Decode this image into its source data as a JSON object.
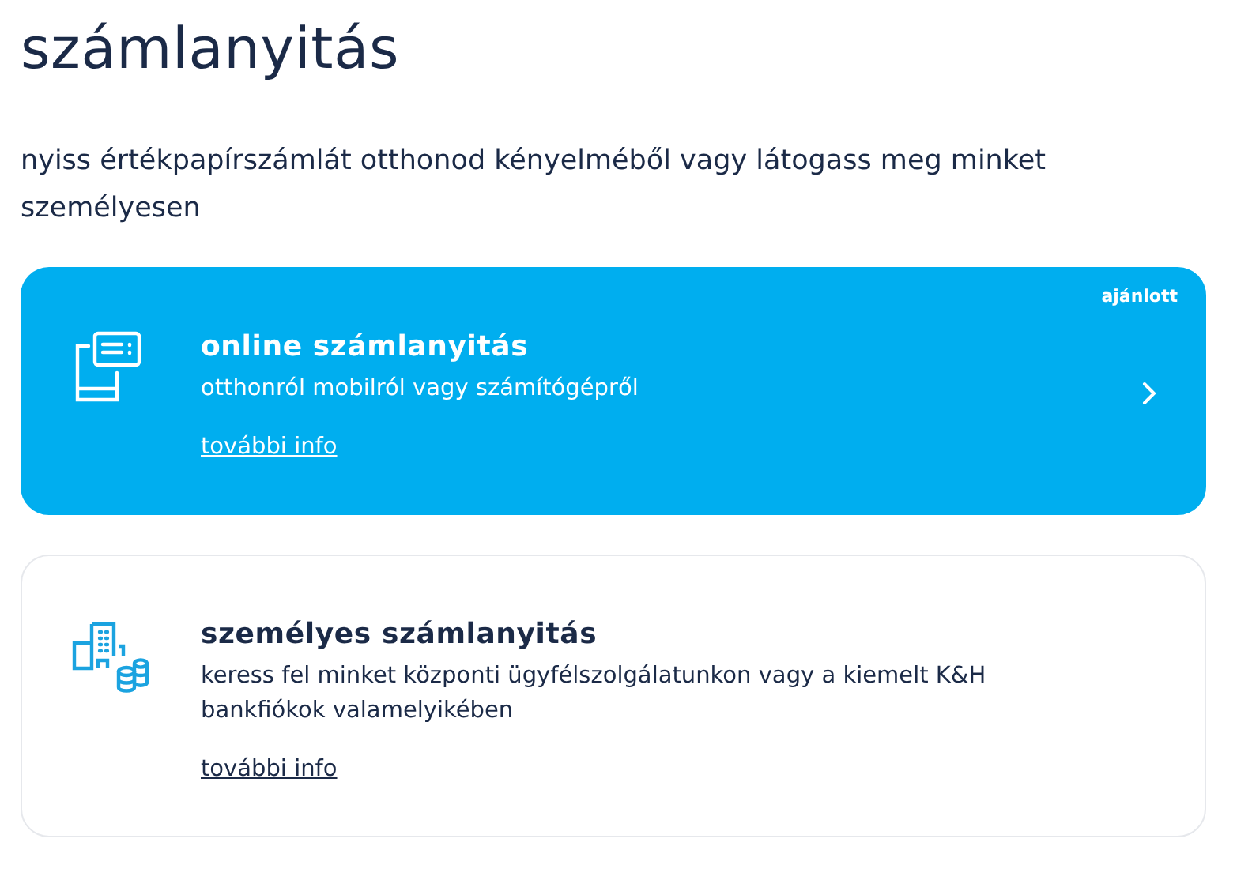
{
  "title": "számlanyitás",
  "subtitle": "nyiss értékpapírszámlát otthonod kényelméből vagy látogass meg minket személyesen",
  "cards": [
    {
      "kind": "mobile",
      "highlighted": true,
      "badge": "ajánlott",
      "title": "online számlanyitás",
      "description": "otthonról mobilról vagy számítógépről",
      "link": "további info"
    },
    {
      "kind": "branch",
      "highlighted": false,
      "title": "személyes számlanyitás",
      "description": "keress fel minket központi ügyfélszolgálatunkon vagy a kiemelt K&H bankfiókok valamelyikében",
      "link": "további info"
    }
  ]
}
